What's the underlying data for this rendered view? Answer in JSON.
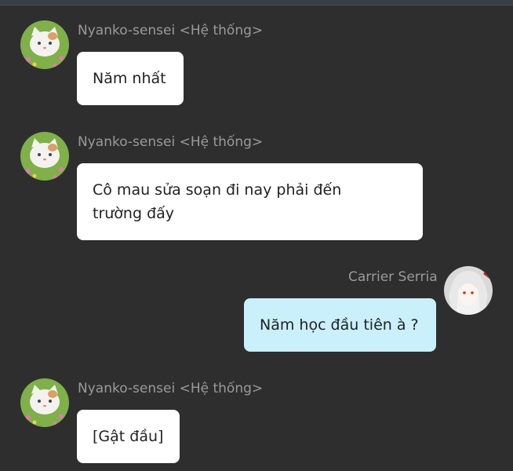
{
  "messages": [
    {
      "sender": "Nyanko-sensei <Hệ thống>",
      "avatar_icon": "cat-avatar-icon",
      "lines": [
        "Năm nhất"
      ]
    },
    {
      "sender": "Nyanko-sensei <Hệ thống>",
      "avatar_icon": "cat-avatar-icon",
      "lines": [
        "Cô mau sửa soạn đi nay phải đến",
        "trường đấy"
      ]
    },
    {
      "sender": "Carrier Serria",
      "avatar_icon": "girl-avatar-icon",
      "lines": [
        "Năm học đầu tiên à ?"
      ]
    },
    {
      "sender": "Nyanko-sensei <Hệ thống>",
      "avatar_icon": "cat-avatar-icon",
      "lines": [
        "[Gật đầu]"
      ]
    }
  ],
  "colors": {
    "background": "#2e2e2e",
    "other_bubble": "#ffffff",
    "self_bubble": "#c9f0fb",
    "sender_text": "#9a9a9a",
    "message_text": "#222222"
  }
}
